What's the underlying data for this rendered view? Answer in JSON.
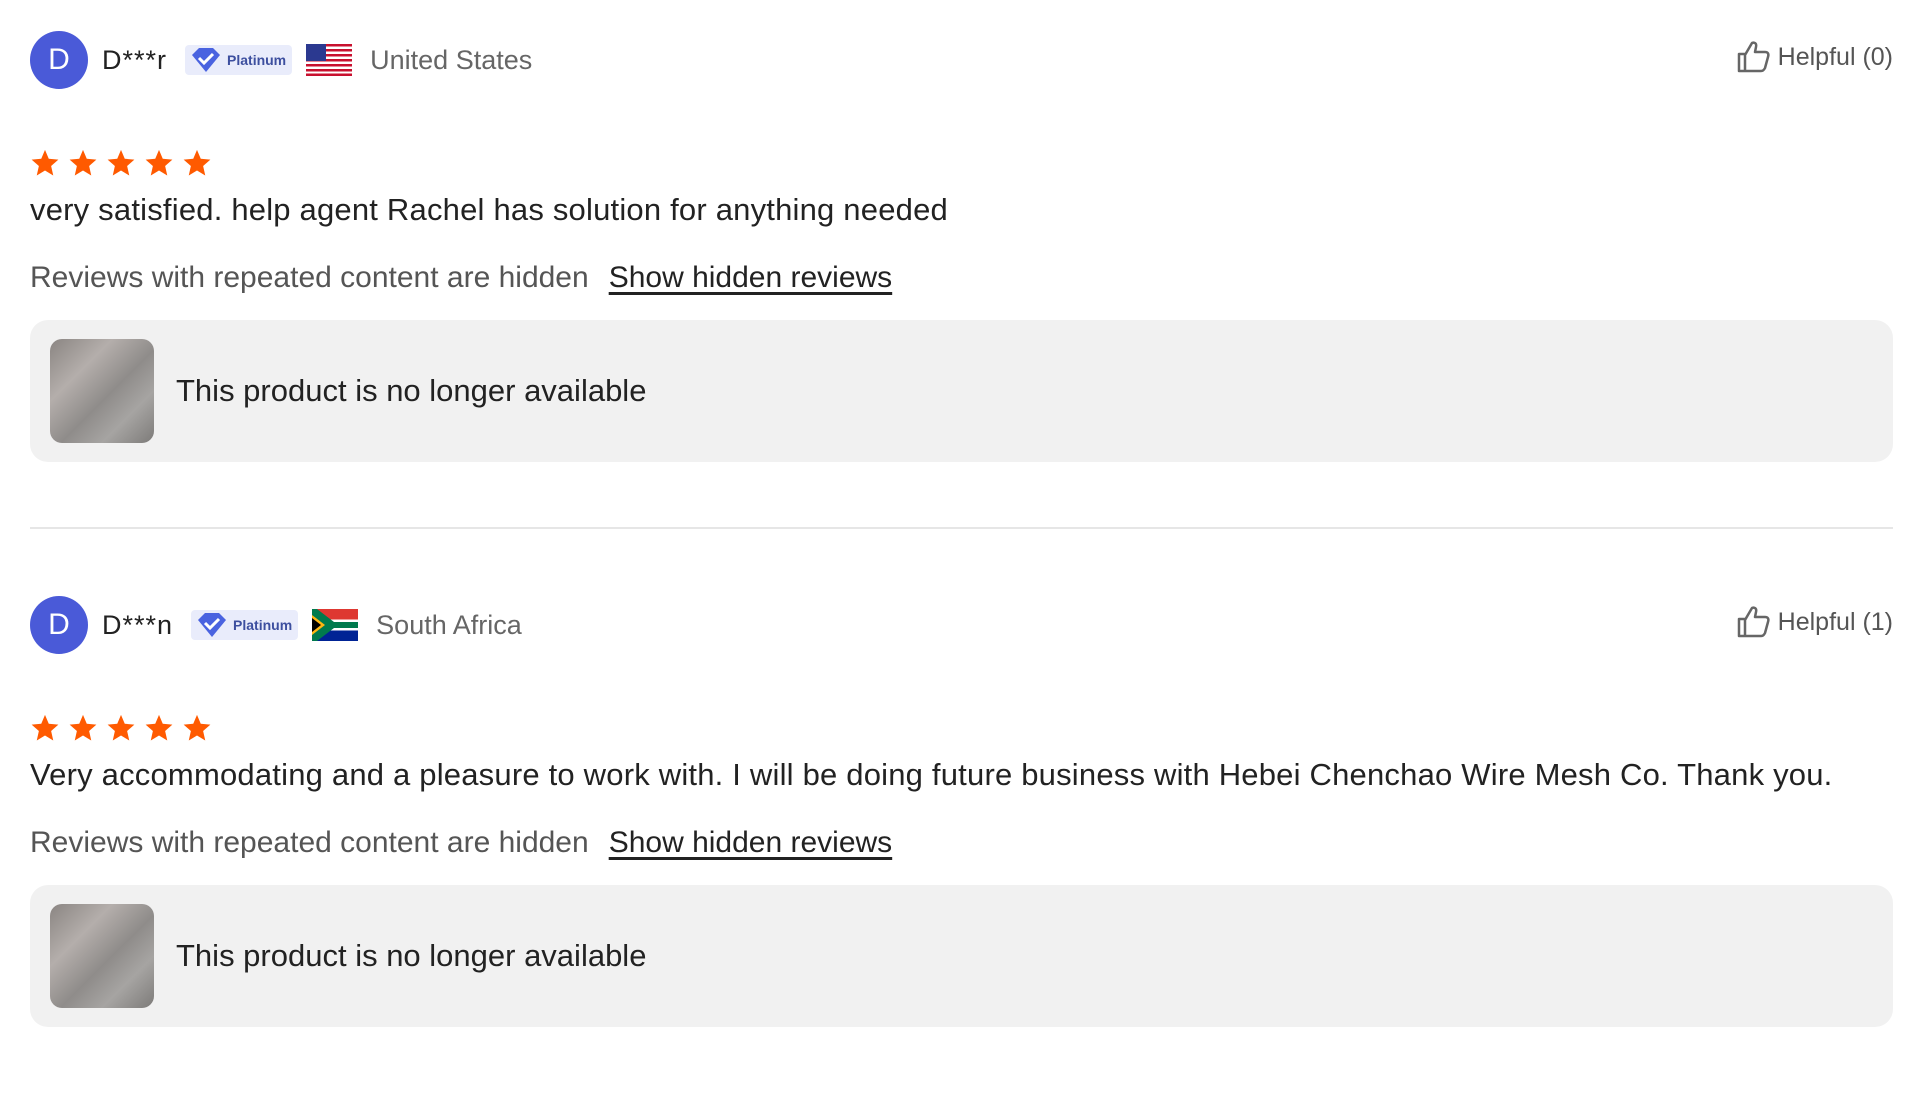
{
  "reviews": [
    {
      "avatar_letter": "D",
      "name": "D***r",
      "badge": "Platinum",
      "country": "United States",
      "flag": "us-flag",
      "helpful": "Helpful (0)",
      "rating": 5,
      "text": "very satisfied. help agent Rachel has solution for anything needed",
      "hidden_notice": "Reviews with repeated content are hidden",
      "show_hidden": "Show hidden reviews",
      "product_status": "This product is no longer available"
    },
    {
      "avatar_letter": "D",
      "name": "D***n",
      "badge": "Platinum",
      "country": "South Africa",
      "flag": "za-flag",
      "helpful": "Helpful (1)",
      "rating": 5,
      "text": "Very accommodating and a pleasure to work with. I will be doing future business with Hebei Chenchao Wire Mesh Co. Thank you.",
      "hidden_notice": "Reviews with repeated content are hidden",
      "show_hidden": "Show hidden reviews",
      "product_status": "This product is no longer available"
    }
  ],
  "colors": {
    "avatar": "#4a5ad8",
    "star": "#ff5a00",
    "badge_bg": "#e9ecfb",
    "product_bg": "#f1f1f1"
  }
}
